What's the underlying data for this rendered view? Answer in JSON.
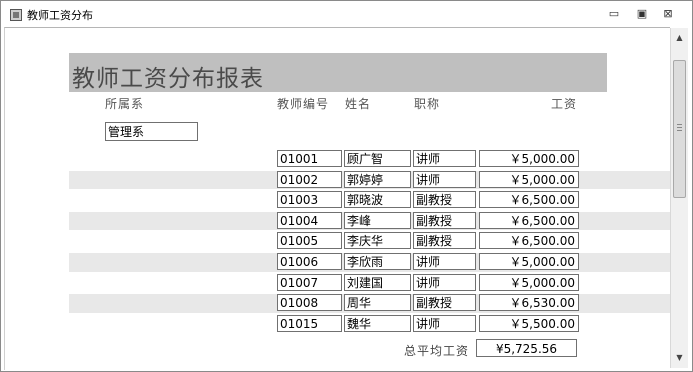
{
  "window": {
    "title": "教师工资分布",
    "minimize_glyph": "▭",
    "maximize_glyph": "▣",
    "close_glyph": "⊠"
  },
  "report": {
    "title": "教师工资分布报表",
    "headers": {
      "department": "所属系",
      "teacher_id": "教师编号",
      "name": "姓名",
      "job_title": "职称",
      "salary": "工资"
    },
    "department_value": "管理系",
    "rows": [
      {
        "id": "01001",
        "name": "顾广智",
        "title": "讲师",
        "salary": "￥5,000.00"
      },
      {
        "id": "01002",
        "name": "郭婷婷",
        "title": "讲师",
        "salary": "￥5,000.00"
      },
      {
        "id": "01003",
        "name": "郭晓波",
        "title": "副教授",
        "salary": "￥6,500.00"
      },
      {
        "id": "01004",
        "name": "李峰",
        "title": "副教授",
        "salary": "￥6,500.00"
      },
      {
        "id": "01005",
        "name": "李庆华",
        "title": "副教授",
        "salary": "￥6,500.00"
      },
      {
        "id": "01006",
        "name": "李欣雨",
        "title": "讲师",
        "salary": "￥5,000.00"
      },
      {
        "id": "01007",
        "name": "刘建国",
        "title": "讲师",
        "salary": "￥5,000.00"
      },
      {
        "id": "01008",
        "name": "周华",
        "title": "副教授",
        "salary": "￥6,530.00"
      },
      {
        "id": "01015",
        "name": "魏华",
        "title": "讲师",
        "salary": "￥5,500.00"
      }
    ],
    "average_label": "总平均工资",
    "average_value": "¥5,725.56"
  },
  "scrollbar": {
    "up_glyph": "▲",
    "down_glyph": "▼"
  },
  "colors": {
    "banner": "#bfbfbf",
    "row_shade": "#e8e8e8"
  },
  "icons": {
    "app": "report-icon",
    "minimize": "minimize-icon",
    "maximize": "maximize-icon",
    "close": "close-icon"
  }
}
